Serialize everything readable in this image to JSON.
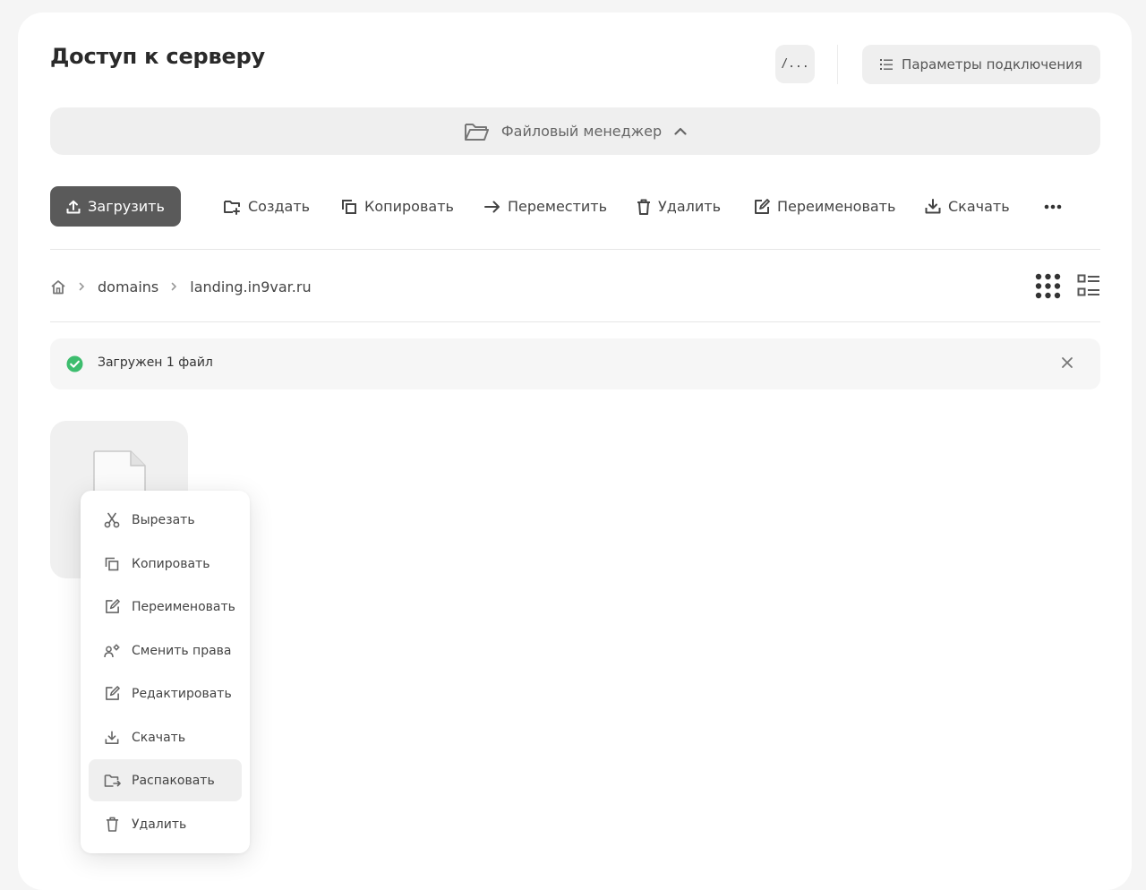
{
  "page": {
    "title": "Доступ к серверу",
    "terminal_label": "/...",
    "connection_params_label": "Параметры подключения"
  },
  "file_manager": {
    "label": "Файловый менеджер",
    "expanded": true
  },
  "toolbar": {
    "upload": "Загрузить",
    "create": "Создать",
    "copy": "Копировать",
    "move": "Переместить",
    "delete": "Удалить",
    "rename": "Переименовать",
    "download": "Скачать"
  },
  "breadcrumb": {
    "home_icon": "home-icon",
    "items": [
      "domains",
      "landing.in9var.ru"
    ]
  },
  "view_modes": [
    "grid",
    "list"
  ],
  "notice": {
    "text": "Загружен 1 файл",
    "status_color": "#3dbd6e"
  },
  "context_menu": {
    "items": [
      {
        "label": "Вырезать",
        "icon": "scissors-icon"
      },
      {
        "label": "Копировать",
        "icon": "copy-icon"
      },
      {
        "label": "Переименовать",
        "icon": "rename-icon"
      },
      {
        "label": "Сменить права",
        "icon": "permissions-icon"
      },
      {
        "label": "Редактировать",
        "icon": "edit-icon"
      },
      {
        "label": "Скачать",
        "icon": "download-icon"
      },
      {
        "label": "Распаковать",
        "icon": "unpack-icon",
        "active": true
      },
      {
        "label": "Удалить",
        "icon": "trash-icon"
      }
    ]
  },
  "colors": {
    "primary_button": "#5a5a5a",
    "surface": "#efefef",
    "success": "#3dbd6e"
  }
}
